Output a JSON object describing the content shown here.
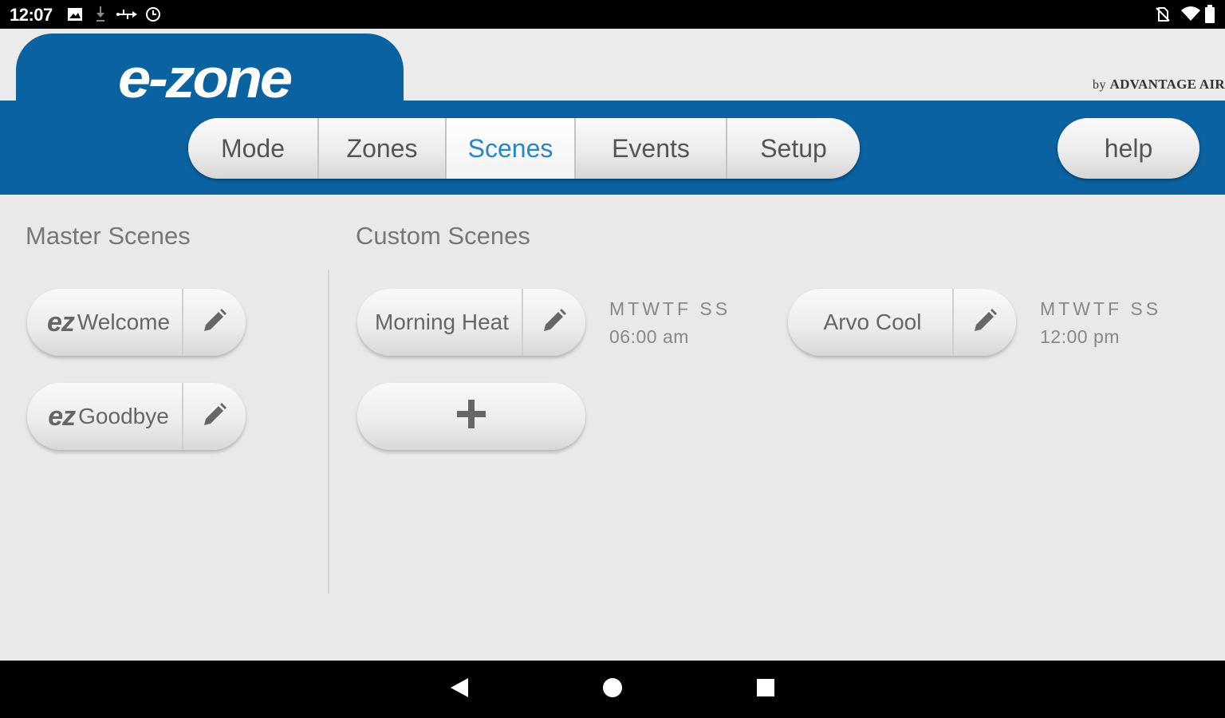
{
  "status_bar": {
    "time": "12:07",
    "left_icons": [
      "image-icon",
      "download-icon",
      "usb-icon",
      "clock-icon"
    ],
    "right_icons": [
      "no-sim-icon",
      "wifi-icon",
      "battery-icon"
    ]
  },
  "header": {
    "logo": "e-zone",
    "byline_prefix": "by",
    "byline_brand": "ADVANTAGE AIR",
    "brand_color": "#0b62a0"
  },
  "tabs": [
    {
      "label": "Mode",
      "active": false
    },
    {
      "label": "Zones",
      "active": false
    },
    {
      "label": "Scenes",
      "active": true
    },
    {
      "label": "Events",
      "active": false
    },
    {
      "label": "Setup",
      "active": false
    }
  ],
  "help_label": "help",
  "master": {
    "title": "Master Scenes",
    "scenes": [
      {
        "prefix": "ez",
        "name": "Welcome"
      },
      {
        "prefix": "ez",
        "name": "Goodbye"
      }
    ]
  },
  "custom": {
    "title": "Custom Scenes",
    "scenes": [
      {
        "name": "Morning Heat",
        "days": "MTWTF SS",
        "time": "06:00 am"
      },
      {
        "name": "Arvo Cool",
        "days": "MTWTF SS",
        "time": "12:00 pm"
      }
    ],
    "add_icon": "plus-icon"
  },
  "nav_bar": {
    "icons": [
      "back-icon",
      "home-icon",
      "recents-icon"
    ]
  }
}
